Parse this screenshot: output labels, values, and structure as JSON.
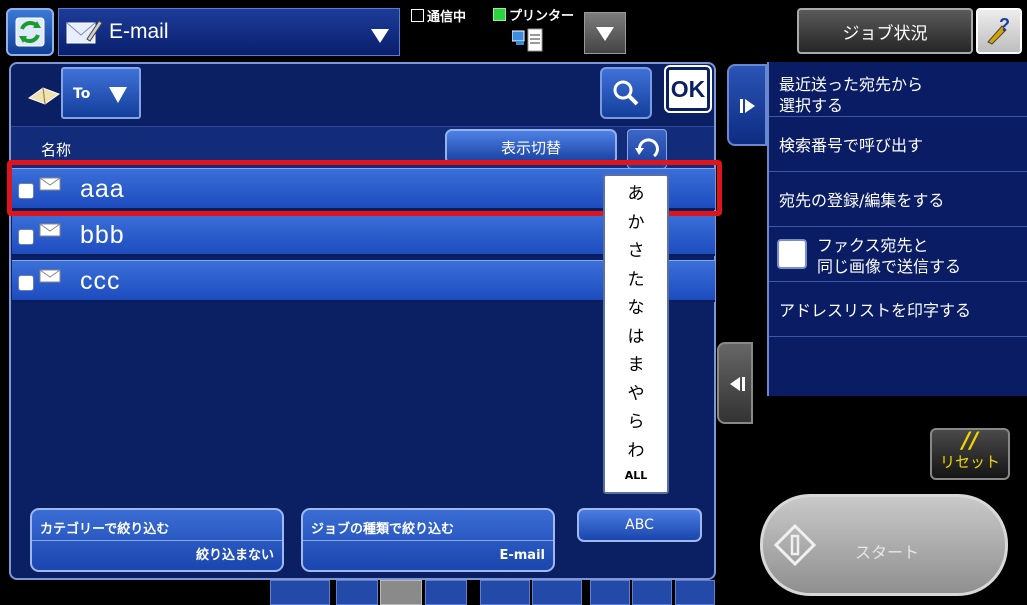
{
  "header": {
    "mode_label": "E-mail",
    "status_comm": "通信中",
    "status_printer": "プリンター",
    "job_status_label": "ジョブ状況"
  },
  "panel": {
    "address_type": "To",
    "ok_label": "OK",
    "column_name": "名称",
    "toggle_view_label": "表示切替",
    "rows": [
      {
        "name": "aaa"
      },
      {
        "name": "bbb"
      },
      {
        "name": "ccc"
      }
    ],
    "kana": [
      "あ",
      "か",
      "さ",
      "た",
      "な",
      "は",
      "ま",
      "や",
      "ら",
      "わ"
    ],
    "kana_all": "ALL",
    "filters": {
      "category_title": "カテゴリーで絞り込む",
      "category_value": "絞り込まない",
      "jobtype_title": "ジョブの種類で絞り込む",
      "jobtype_value": "E-mail",
      "abc_label": "ABC"
    }
  },
  "side_menu": {
    "items": [
      "最近送った宛先から\n選択する",
      "検索番号で呼び出す",
      "宛先の登録/編集をする",
      "ファクス宛先と\n同じ画像で送信する",
      "アドレスリストを印字する"
    ]
  },
  "controls": {
    "reset_label": "リセット",
    "start_label": "スタート"
  },
  "colors": {
    "highlight": "#e0141b",
    "panel_bg": "#0b1f63",
    "row_blue": "#2f5fd0",
    "reset_yellow": "#f2d400"
  }
}
